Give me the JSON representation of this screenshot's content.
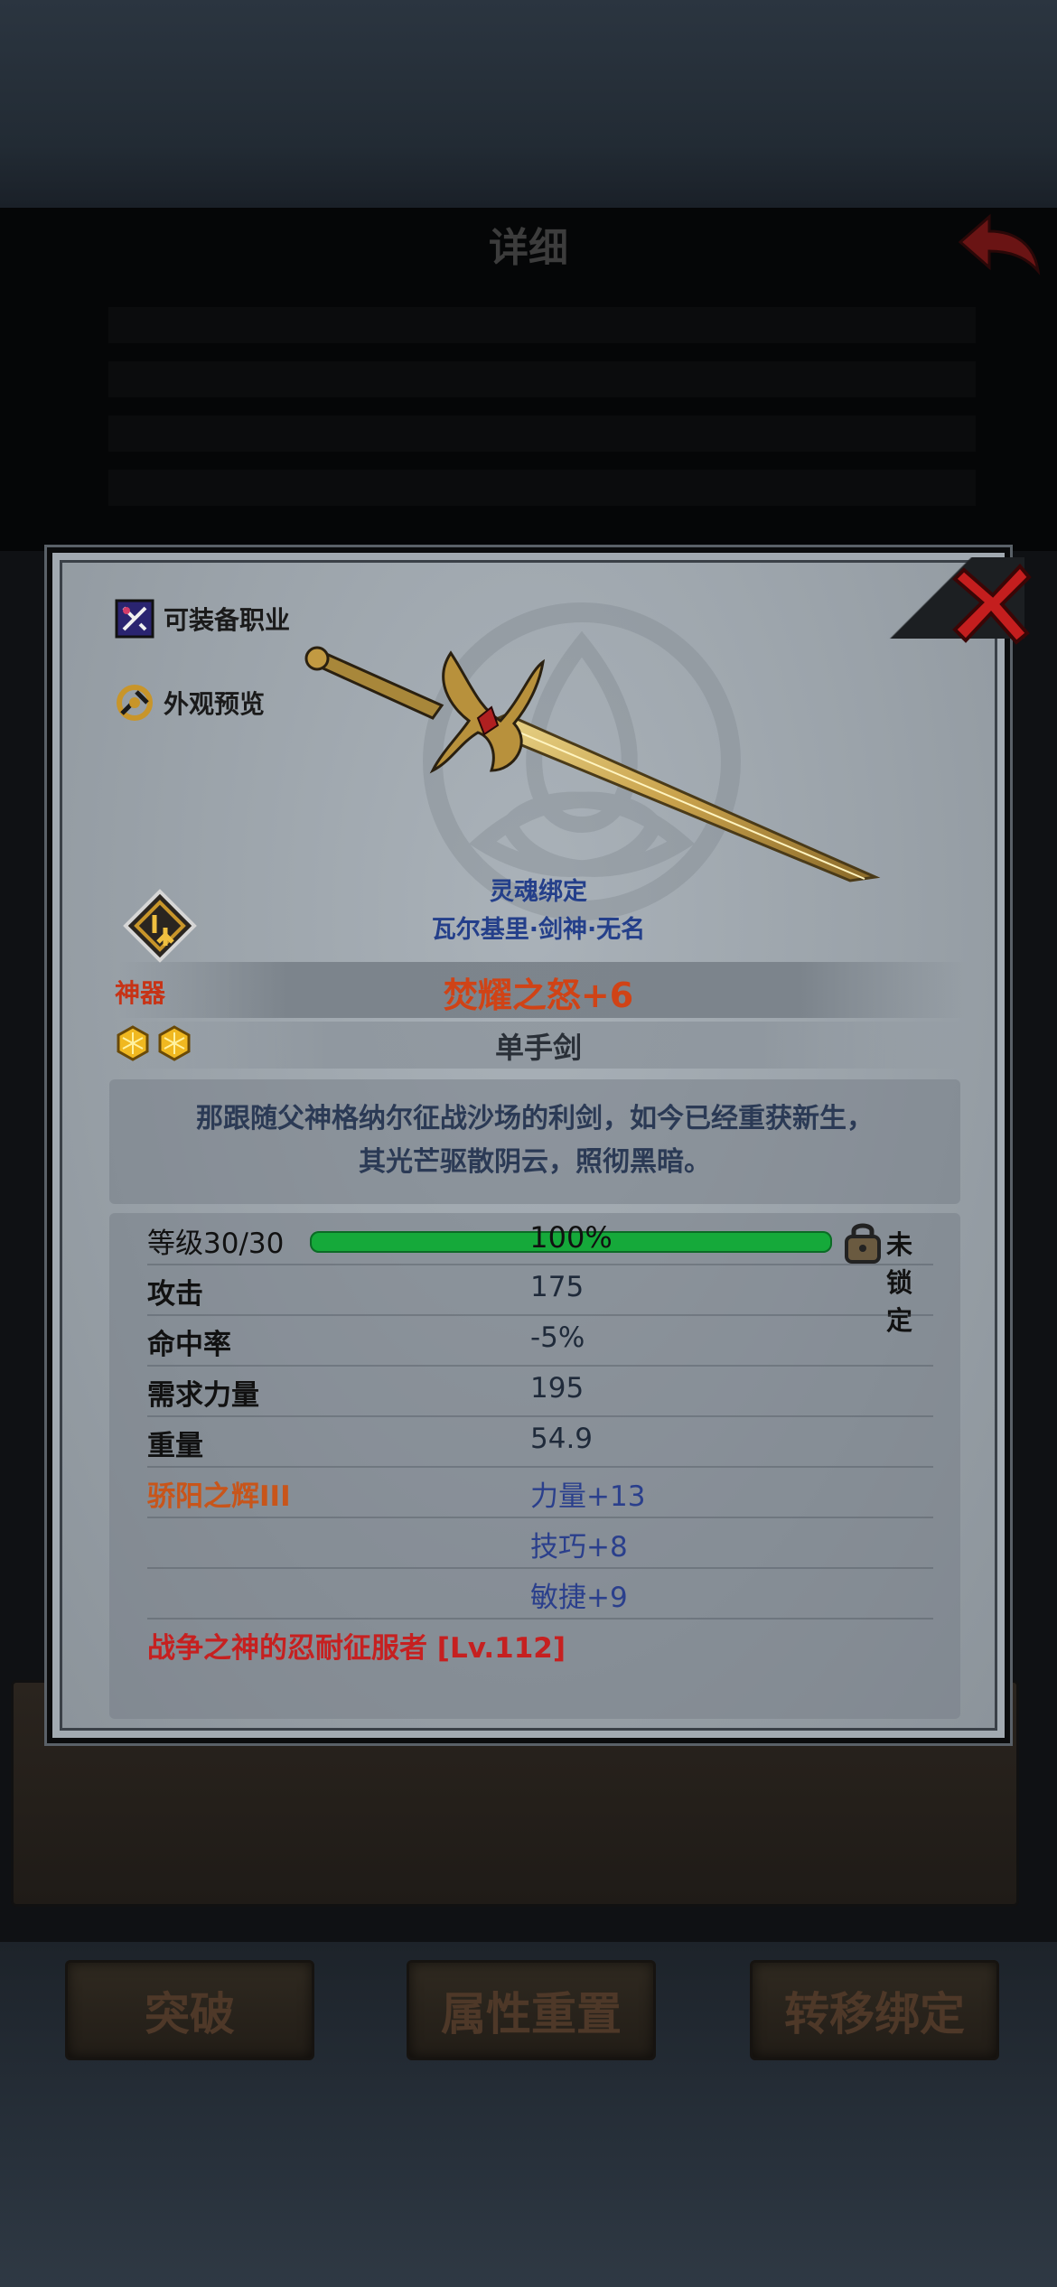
{
  "header": {
    "title": "详细"
  },
  "modal": {
    "side_buttons": [
      {
        "label": "可装备职业",
        "icon": "class-icon"
      },
      {
        "label": "外观预览",
        "icon": "preview-icon"
      }
    ],
    "soul_bound_label": "灵魂绑定",
    "bound_to": "瓦尔基里·剑神·无名",
    "grade": "神器",
    "item_name": "焚耀之怒+6",
    "item_type": "单手剑",
    "star_count": 2,
    "description_lines": [
      "那跟随父神格纳尔征战沙场的利剑，如今已经重获新生，",
      "其光芒驱散阴云，照彻黑暗。"
    ],
    "level": {
      "label": "等级30/30",
      "progress_percent": 100,
      "progress_text": "100%",
      "lock_status": "未锁定"
    },
    "stats": [
      {
        "name": "攻击",
        "value": "175"
      },
      {
        "name": "命中率",
        "value": "-5%"
      },
      {
        "name": "需求力量",
        "value": "195"
      },
      {
        "name": "重量",
        "value": "54.9"
      }
    ],
    "enchant": {
      "name": "骄阳之辉III",
      "bonuses": [
        "力量+13",
        "技巧+8",
        "敏捷+9"
      ]
    },
    "set_effect": "战争之神的忍耐征服者 [Lv.112]"
  },
  "actions": {
    "breakthrough": "突破",
    "reset_attributes": "属性重置",
    "transfer_binding": "转移绑定"
  },
  "colors": {
    "item_name": "#d04316",
    "grade": "#c73316",
    "soul_bound": "#243f8a",
    "enchant": "#c8551a",
    "set_effect": "#c62020",
    "progress_bar": "#15a93a",
    "close": "#c41e1e"
  }
}
